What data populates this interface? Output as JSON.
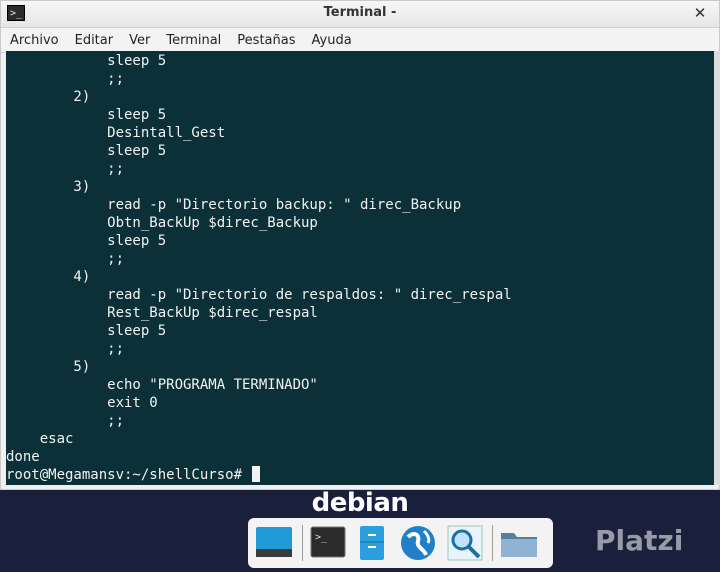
{
  "window": {
    "title": "Terminal -",
    "app_icon_text": ">_"
  },
  "menubar": {
    "items": [
      "Archivo",
      "Editar",
      "Ver",
      "Terminal",
      "Pestañas",
      "Ayuda"
    ]
  },
  "terminal": {
    "lines": [
      "            sleep 5",
      "            ;;",
      "        2)",
      "            sleep 5",
      "            Desintall_Gest",
      "            sleep 5",
      "            ;;",
      "        3)",
      "            read -p \"Directorio backup: \" direc_Backup",
      "            Obtn_BackUp $direc_Backup",
      "            sleep 5",
      "            ;;",
      "        4)",
      "            read -p \"Directorio de respaldos: \" direc_respal",
      "            Rest_BackUp $direc_respal",
      "            sleep 5",
      "            ;;",
      "        5)",
      "            echo \"PROGRAMA TERMINADO\"",
      "            exit 0",
      "            ;;",
      "    esac",
      "done",
      "root@Megamansv:~/shellCurso# "
    ]
  },
  "desktop": {
    "label": "debian",
    "watermark": "Platzi"
  },
  "dock": {
    "items": [
      "desktop-icon",
      "terminal-icon",
      "file-cabinet-icon",
      "globe-icon",
      "magnifier-icon",
      "folder-icon"
    ]
  },
  "colors": {
    "terminal_bg": "#0b3038",
    "terminal_fg": "#f2f2f2",
    "desktop_bg": "#1a1f3c"
  }
}
